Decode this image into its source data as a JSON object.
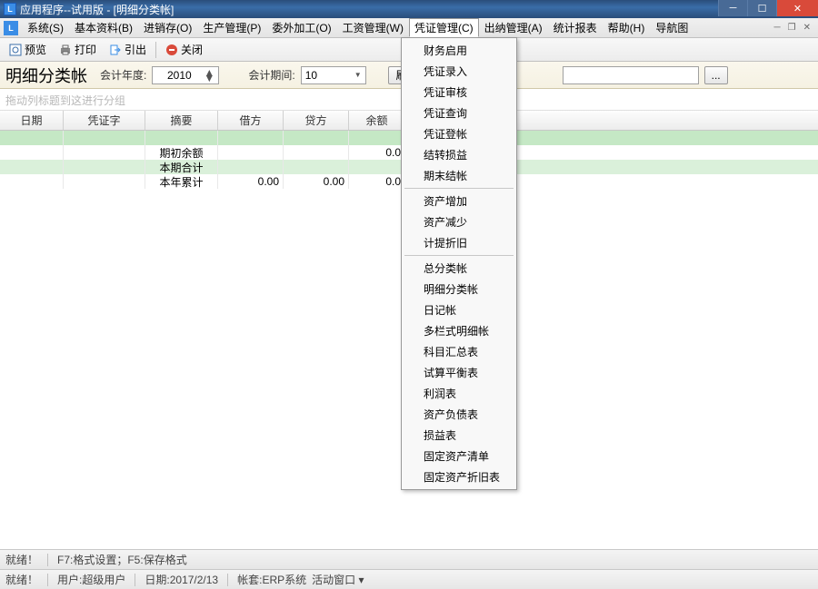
{
  "title": "应用程序--试用版 - [明细分类帐]",
  "menus": {
    "system": "系统(S)",
    "basic": "基本资料(B)",
    "inv": "进销存(O)",
    "prod": "生产管理(P)",
    "outsrc": "委外加工(O)",
    "wage": "工资管理(W)",
    "voucher": "凭证管理(C)",
    "cash": "出纳管理(A)",
    "stat": "统计报表",
    "help": "帮助(H)",
    "nav": "导航图"
  },
  "toolbar": {
    "preview": "预览",
    "print": "打印",
    "export": "引出",
    "close": "关闭"
  },
  "filter": {
    "page_title": "明细分类帐",
    "year_label": "会计年度:",
    "year_value": "2010",
    "period_label": "会计期间:",
    "period_value": "10",
    "refresh_partial": "刷",
    "ellipsis": "..."
  },
  "grid": {
    "group_hint": "拖动列标题到这进行分组",
    "cols": {
      "date": "日期",
      "voucher": "凭证字",
      "summary": "摘要",
      "debit": "借方",
      "credit": "贷方",
      "balance": "余额"
    },
    "rows": [
      {
        "summary": "",
        "debit": "",
        "credit": "",
        "balance": ""
      },
      {
        "summary": "期初余额",
        "debit": "",
        "credit": "",
        "balance": "0.0"
      },
      {
        "summary": "本期合计",
        "debit": "",
        "credit": "",
        "balance": ""
      },
      {
        "summary": "本年累计",
        "debit": "0.00",
        "credit": "0.00",
        "balance": "0.0"
      }
    ]
  },
  "dropdown": [
    "财务启用",
    "凭证录入",
    "凭证审核",
    "凭证查询",
    "凭证登帐",
    "结转损益",
    "期末结帐",
    "-",
    "资产增加",
    "资产减少",
    "计提折旧",
    "-",
    "总分类帐",
    "明细分类帐",
    "日记帐",
    "多栏式明细帐",
    "科目汇总表",
    "试算平衡表",
    "利润表",
    "资产负债表",
    "损益表",
    "固定资产清单",
    "固定资产折旧表"
  ],
  "status": {
    "ready": "就绪！",
    "hint": "F7:格式设置；F5:保存格式",
    "user_label": "用户:",
    "user": "超级用户",
    "date_label": "日期:",
    "date": "2017/2/13",
    "acct_label": "帐套:",
    "acct": "ERP系统",
    "window": "活动窗口 ▾"
  }
}
